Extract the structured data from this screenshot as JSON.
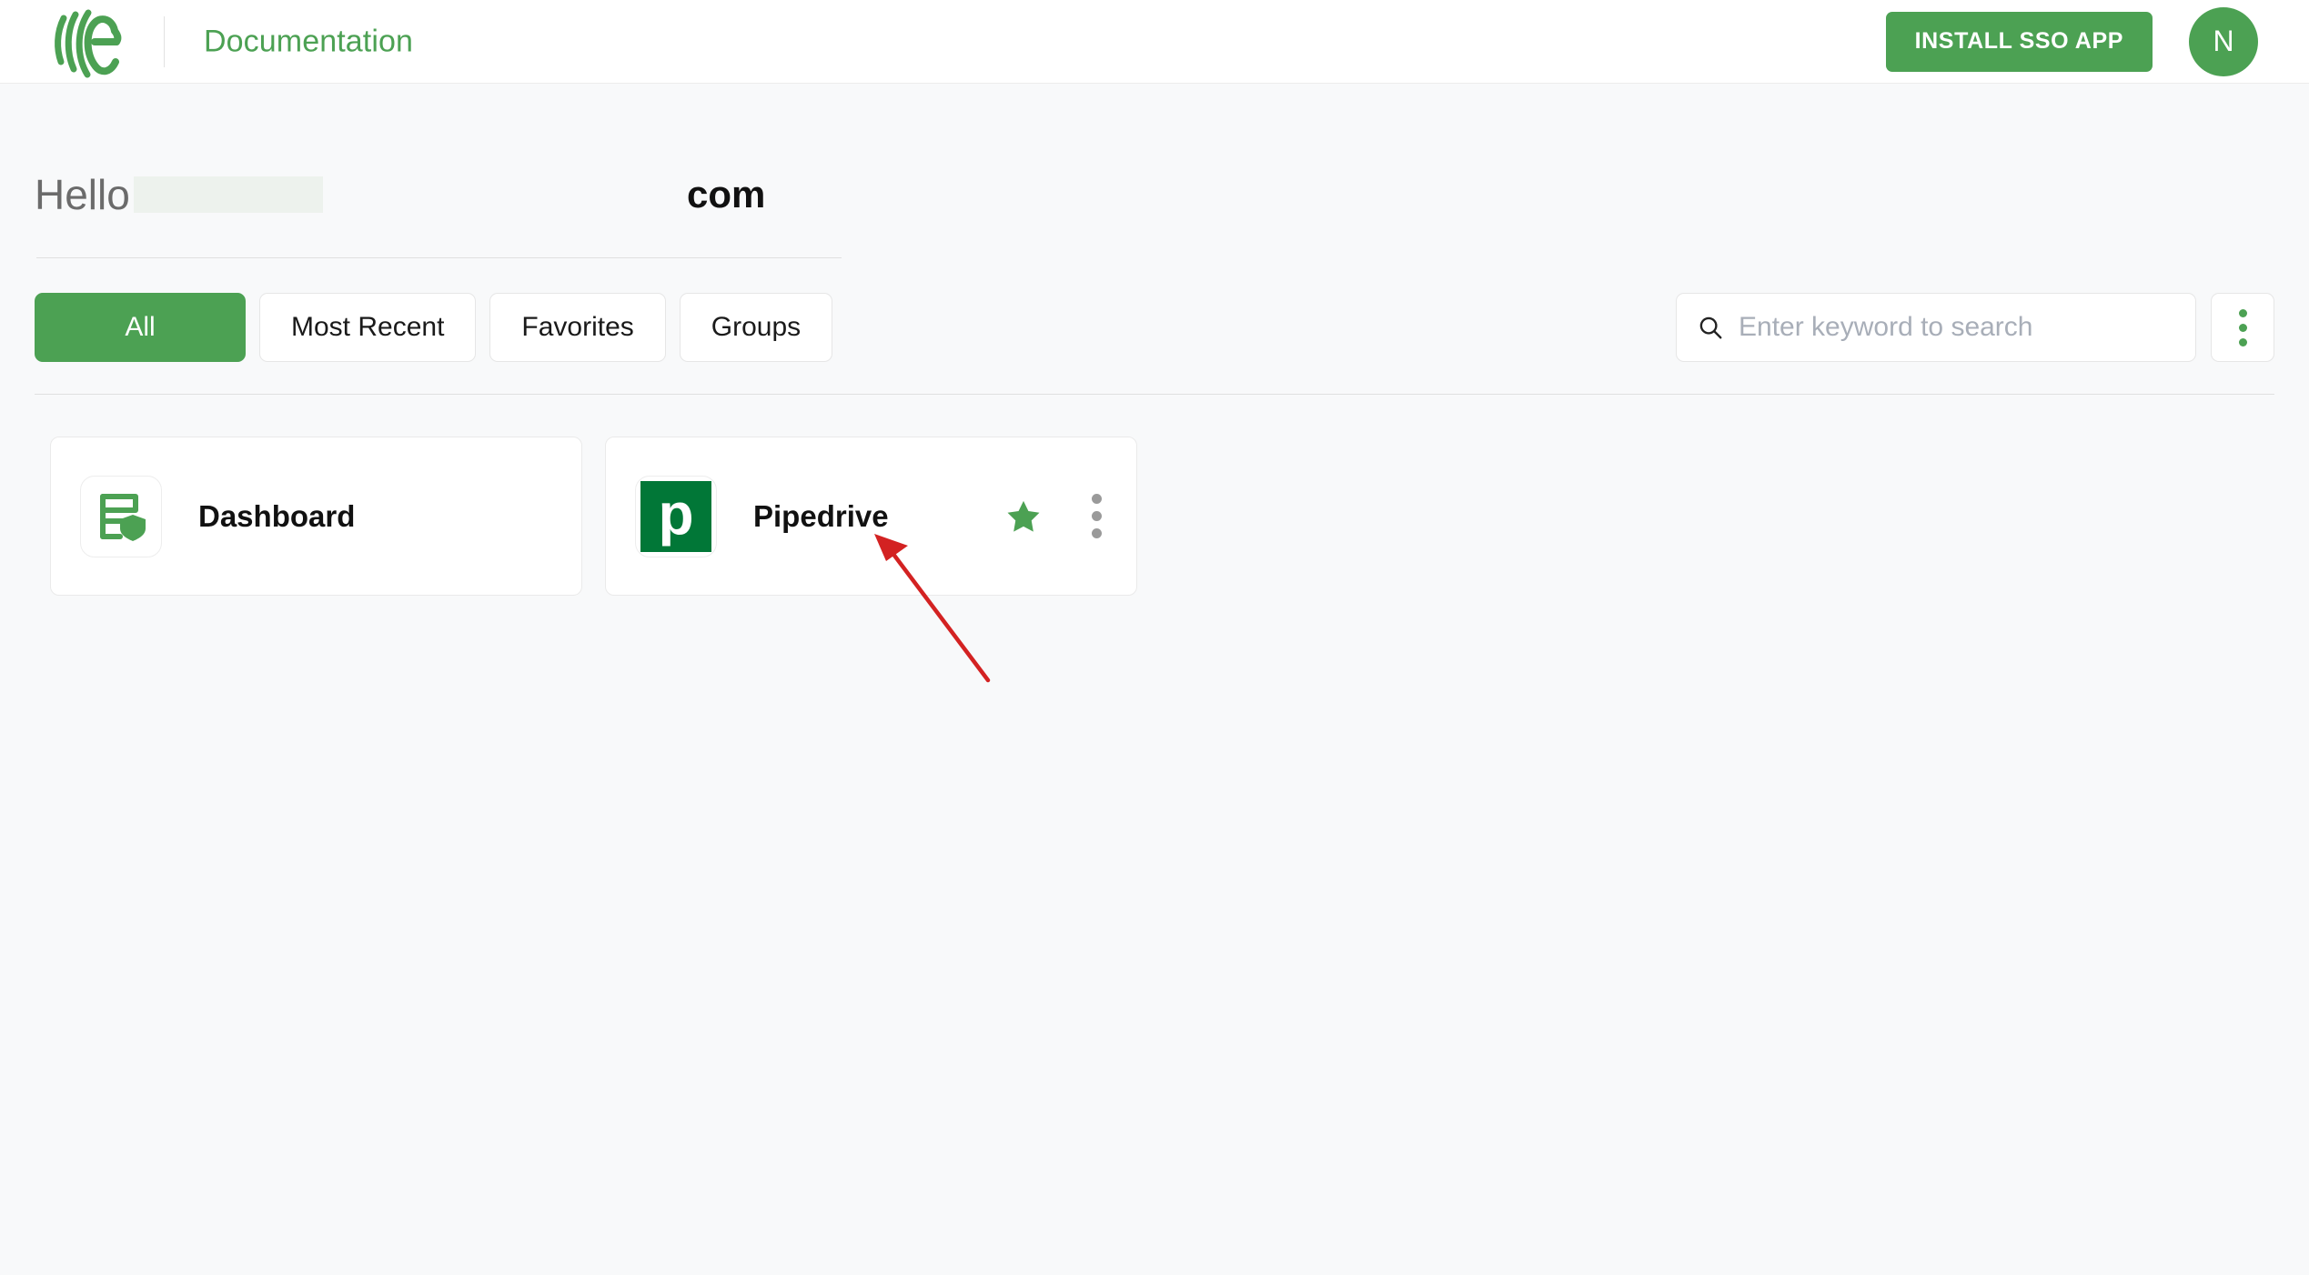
{
  "header": {
    "logo_icon": "miniorange-logo-icon",
    "title": "Documentation",
    "install_button_label": "INSTALL SSO APP",
    "avatar_initial": "N"
  },
  "greeting": {
    "hello_label": "Hello",
    "redacted_name": "",
    "domain_suffix": "com"
  },
  "filters": {
    "tabs": [
      {
        "id": "all",
        "label": "All",
        "active": true
      },
      {
        "id": "most-recent",
        "label": "Most Recent",
        "active": false
      },
      {
        "id": "favorites",
        "label": "Favorites",
        "active": false
      },
      {
        "id": "groups",
        "label": "Groups",
        "active": false
      }
    ]
  },
  "search": {
    "icon": "search-icon",
    "placeholder": "Enter keyword to search",
    "value": "",
    "options_icon": "vertical-dots-icon"
  },
  "apps": [
    {
      "name": "Dashboard",
      "icon": "dashboard-shield-icon",
      "favorite": false,
      "has_menu": false
    },
    {
      "name": "Pipedrive",
      "icon": "pipedrive-icon",
      "icon_letter": "p",
      "favorite": true,
      "has_menu": true,
      "menu_icon": "vertical-dots-icon",
      "favorite_icon": "star-filled-icon"
    }
  ],
  "annotation": {
    "type": "arrow",
    "color": "#D32222"
  },
  "colors": {
    "brand_green": "#4CA153",
    "pipedrive_green": "#017737",
    "page_background": "#F8F9FA",
    "header_background": "#FFFFFF",
    "annotation_red": "#D32222"
  }
}
